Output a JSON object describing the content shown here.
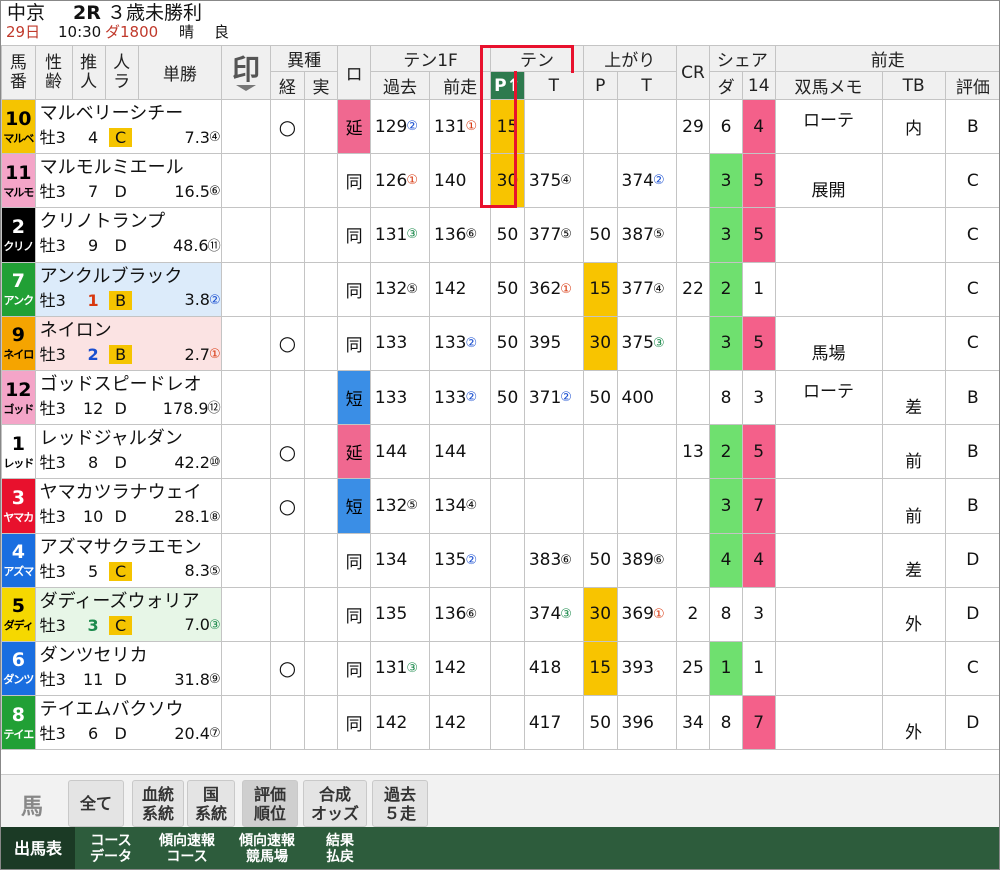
{
  "header": {
    "venue": "中京",
    "race": "2R",
    "race_name": "３歳未勝利",
    "date": "29日",
    "time": "10:30",
    "course": "ダ1800",
    "weather": "晴",
    "going": "良"
  },
  "columns": {
    "umaban": "馬番",
    "seirei": "性齢",
    "suijin": "推人",
    "ninki": "人ラ",
    "tansho": "単勝",
    "shirushi": "印",
    "ishu": "異種",
    "kei": "経",
    "jitsu": "実",
    "ro": "ロ",
    "ten1f": "テン1F",
    "kako": "過去",
    "zenso": "前走",
    "ten": "テン",
    "ten_p": "P↑",
    "ten_t": "T",
    "agari": "上がり",
    "agari_p": "P",
    "agari_t": "T",
    "cr": "CR",
    "share": "シェア",
    "share_da": "ダ",
    "share_14": "14",
    "zenso_group": "前走",
    "soba_memo": "双馬メモ",
    "tb": "TB",
    "hyoka": "評価"
  },
  "horses": [
    {
      "no": "10",
      "abbr": "マルベ",
      "name": "マルベリーシチー",
      "sex": "牡3",
      "jockey_rank": "4",
      "mark": "C",
      "odds": "7.3",
      "odds_rank": "④",
      "kei": "○",
      "ro": "延",
      "kako": "129",
      "kako_r": "②",
      "zenso": "131",
      "zenso_r": "①",
      "ten_p": "15",
      "ten_t": "",
      "ten_t_r": "",
      "ag_p": "",
      "ag_t": "",
      "ag_t_r": "",
      "cr": "29",
      "da": "6",
      "s14": "4",
      "memo": "ローテ",
      "tb": "内",
      "hyoka": "B"
    },
    {
      "no": "11",
      "abbr": "マルモ",
      "name": "マルモルミエール",
      "sex": "牡3",
      "jockey_rank": "7",
      "mark": "D",
      "odds": "16.5",
      "odds_rank": "⑥",
      "kei": "",
      "ro": "同",
      "kako": "126",
      "kako_r": "①",
      "zenso": "140",
      "zenso_r": "",
      "ten_p": "30",
      "ten_t": "375",
      "ten_t_r": "④",
      "ag_p": "",
      "ag_t": "374",
      "ag_t_r": "②",
      "cr": "",
      "da": "3",
      "s14": "5",
      "memo": "展開",
      "tb": "",
      "hyoka": "C"
    },
    {
      "no": "2",
      "abbr": "クリノ",
      "name": "クリノトランプ",
      "sex": "牡3",
      "jockey_rank": "9",
      "mark": "D",
      "odds": "48.6",
      "odds_rank": "⑪",
      "kei": "",
      "ro": "同",
      "kako": "131",
      "kako_r": "③",
      "zenso": "136",
      "zenso_r": "⑥",
      "ten_p": "50",
      "ten_t": "377",
      "ten_t_r": "⑤",
      "ag_p": "50",
      "ag_t": "387",
      "ag_t_r": "⑤",
      "cr": "",
      "da": "3",
      "s14": "5",
      "memo": "",
      "tb": "",
      "hyoka": "C"
    },
    {
      "no": "7",
      "abbr": "アンク",
      "name": "アンクルブラック",
      "sex": "牡3",
      "jockey_rank": "1",
      "mark": "B",
      "odds": "3.8",
      "odds_rank": "②",
      "kei": "",
      "ro": "同",
      "kako": "132",
      "kako_r": "⑤",
      "zenso": "142",
      "zenso_r": "",
      "ten_p": "50",
      "ten_t": "362",
      "ten_t_r": "①",
      "ag_p": "15",
      "ag_t": "377",
      "ag_t_r": "④",
      "cr": "22",
      "da": "2",
      "s14": "1",
      "memo": "",
      "tb": "",
      "hyoka": "C"
    },
    {
      "no": "9",
      "abbr": "ネイロ",
      "name": "ネイロン",
      "sex": "牡3",
      "jockey_rank": "2",
      "mark": "B",
      "odds": "2.7",
      "odds_rank": "①",
      "kei": "○",
      "ro": "同",
      "kako": "133",
      "kako_r": "",
      "zenso": "133",
      "zenso_r": "②",
      "ten_p": "50",
      "ten_t": "395",
      "ten_t_r": "",
      "ag_p": "30",
      "ag_t": "375",
      "ag_t_r": "③",
      "cr": "",
      "da": "3",
      "s14": "5",
      "memo": "馬場",
      "tb": "",
      "hyoka": "C"
    },
    {
      "no": "12",
      "abbr": "ゴッド",
      "name": "ゴッドスピードレオ",
      "sex": "牡3",
      "jockey_rank": "12",
      "mark": "D",
      "odds": "178.9",
      "odds_rank": "⑫",
      "kei": "",
      "ro": "短",
      "kako": "133",
      "kako_r": "",
      "zenso": "133",
      "zenso_r": "②",
      "ten_p": "50",
      "ten_t": "371",
      "ten_t_r": "②",
      "ag_p": "50",
      "ag_t": "400",
      "ag_t_r": "",
      "cr": "",
      "da": "8",
      "s14": "3",
      "memo": "ローテ",
      "tb": "差",
      "hyoka": "B"
    },
    {
      "no": "1",
      "abbr": "レッド",
      "name": "レッドジャルダン",
      "sex": "牡3",
      "jockey_rank": "8",
      "mark": "D",
      "odds": "42.2",
      "odds_rank": "⑩",
      "kei": "○",
      "ro": "延",
      "kako": "144",
      "kako_r": "",
      "zenso": "144",
      "zenso_r": "",
      "ten_p": "",
      "ten_t": "",
      "ten_t_r": "",
      "ag_p": "",
      "ag_t": "",
      "ag_t_r": "",
      "cr": "13",
      "da": "2",
      "s14": "5",
      "memo": "",
      "tb": "前",
      "hyoka": "B"
    },
    {
      "no": "3",
      "abbr": "ヤマカ",
      "name": "ヤマカツラナウェイ",
      "sex": "牡3",
      "jockey_rank": "10",
      "mark": "D",
      "odds": "28.1",
      "odds_rank": "⑧",
      "kei": "○",
      "ro": "短",
      "kako": "132",
      "kako_r": "⑤",
      "zenso": "134",
      "zenso_r": "④",
      "ten_p": "",
      "ten_t": "",
      "ten_t_r": "",
      "ag_p": "",
      "ag_t": "",
      "ag_t_r": "",
      "cr": "",
      "da": "3",
      "s14": "7",
      "memo": "",
      "tb": "前",
      "hyoka": "B"
    },
    {
      "no": "4",
      "abbr": "アズマ",
      "name": "アズマサクラエモン",
      "sex": "牡3",
      "jockey_rank": "5",
      "mark": "C",
      "odds": "8.3",
      "odds_rank": "⑤",
      "kei": "",
      "ro": "同",
      "kako": "134",
      "kako_r": "",
      "zenso": "135",
      "zenso_r": "②",
      "ten_p": "",
      "ten_t": "383",
      "ten_t_r": "⑥",
      "ag_p": "50",
      "ag_t": "389",
      "ag_t_r": "⑥",
      "cr": "",
      "da": "4",
      "s14": "4",
      "memo": "",
      "tb": "差",
      "hyoka": "D"
    },
    {
      "no": "5",
      "abbr": "ダディ",
      "name": "ダディーズウォリア",
      "sex": "牡3",
      "jockey_rank": "3",
      "mark": "C",
      "odds": "7.0",
      "odds_rank": "③",
      "kei": "",
      "ro": "同",
      "kako": "135",
      "kako_r": "",
      "zenso": "136",
      "zenso_r": "⑥",
      "ten_p": "",
      "ten_t": "374",
      "ten_t_r": "③",
      "ag_p": "30",
      "ag_t": "369",
      "ag_t_r": "①",
      "cr": "2",
      "da": "8",
      "s14": "3",
      "memo": "",
      "tb": "外",
      "hyoka": "D"
    },
    {
      "no": "6",
      "abbr": "ダンツ",
      "name": "ダンツセリカ",
      "sex": "牡3",
      "jockey_rank": "11",
      "mark": "D",
      "odds": "31.8",
      "odds_rank": "⑨",
      "kei": "○",
      "ro": "同",
      "kako": "131",
      "kako_r": "③",
      "zenso": "142",
      "zenso_r": "",
      "ten_p": "",
      "ten_t": "418",
      "ten_t_r": "",
      "ag_p": "15",
      "ag_t": "393",
      "ag_t_r": "",
      "cr": "25",
      "da": "1",
      "s14": "1",
      "memo": "",
      "tb": "",
      "hyoka": "C"
    },
    {
      "no": "8",
      "abbr": "テイエ",
      "name": "テイエムバクソウ",
      "sex": "牡3",
      "jockey_rank": "6",
      "mark": "D",
      "odds": "20.4",
      "odds_rank": "⑦",
      "kei": "",
      "ro": "同",
      "kako": "142",
      "kako_r": "",
      "zenso": "142",
      "zenso_r": "",
      "ten_p": "",
      "ten_t": "417",
      "ten_t_r": "",
      "ag_p": "50",
      "ag_t": "396",
      "ag_t_r": "",
      "cr": "34",
      "da": "8",
      "s14": "7",
      "memo": "",
      "tb": "外",
      "hyoka": "D"
    }
  ],
  "colors": {
    "waku_yellow": "#f5c400",
    "waku_pink": "#f4a5c8",
    "waku_black": "#000000",
    "waku_green": "#21a035",
    "waku_red": "#e8112d",
    "waku_blue": "#1a6ee0",
    "waku_white": "#ffffff",
    "waku_orange": "#f5a400",
    "highlight_yellow": "#f8c400",
    "share_green": "#6fe06f",
    "share_pink": "#f4608a",
    "tag_en": "#f06890",
    "tag_tan": "#3a8ee6",
    "footer_green": "#2d5c3c",
    "callout_red": "#e8112d"
  },
  "tabs_row1": {
    "uma": "馬",
    "items": [
      {
        "label": "全て"
      },
      {
        "label": "血統\n系統"
      },
      {
        "label": "国\n系統"
      },
      {
        "label": "評価\n順位"
      },
      {
        "label": "合成\nオッズ"
      },
      {
        "label": "過去\n５走"
      }
    ]
  },
  "tabs_row2": {
    "items": [
      {
        "label": "出馬表"
      },
      {
        "label": "コース\nデータ"
      },
      {
        "label": "傾向速報\nコース"
      },
      {
        "label": "傾向速報\n競馬場"
      },
      {
        "label": "結果\n払戻"
      }
    ]
  }
}
